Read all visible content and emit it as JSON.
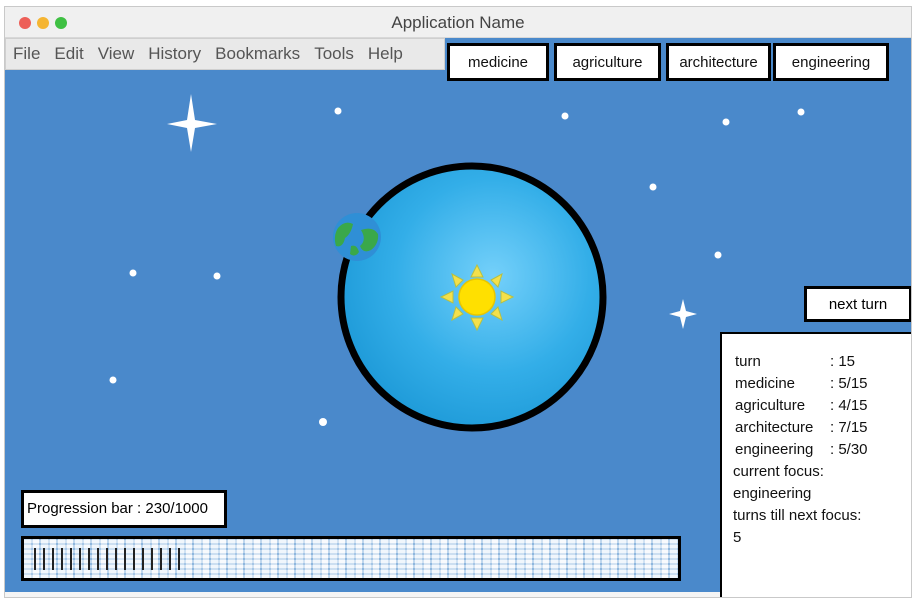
{
  "window": {
    "title": "Application Name"
  },
  "menu": [
    "File",
    "Edit",
    "View",
    "History",
    "Bookmarks",
    "Tools",
    "Help"
  ],
  "focus_buttons": [
    "medicine",
    "agriculture",
    "architecture",
    "engineering"
  ],
  "next_turn_label": "next turn",
  "stats": {
    "rows": [
      {
        "label": "turn",
        "value": ": 15"
      },
      {
        "label": "medicine",
        "value": ": 5/15"
      },
      {
        "label": "agriculture",
        "value": ": 4/15"
      },
      {
        "label": "architecture",
        "value": ": 7/15"
      },
      {
        "label": "engineering",
        "value": ": 5/30"
      }
    ],
    "current_focus_label": "current focus:",
    "current_focus_value": "engineering",
    "turns_till_label": "turns till next focus:",
    "turns_till_value": "5"
  },
  "progress": {
    "label": "Progression bar : 230/1000",
    "current": 230,
    "max": 1000
  },
  "colors": {
    "sky": "#4a89cb",
    "planet_ring": "#000000",
    "planet_fill": "#3aa9e6",
    "sun": "#ffe000",
    "earth_ocean": "#2f8fd6",
    "earth_land": "#3aa84a"
  }
}
